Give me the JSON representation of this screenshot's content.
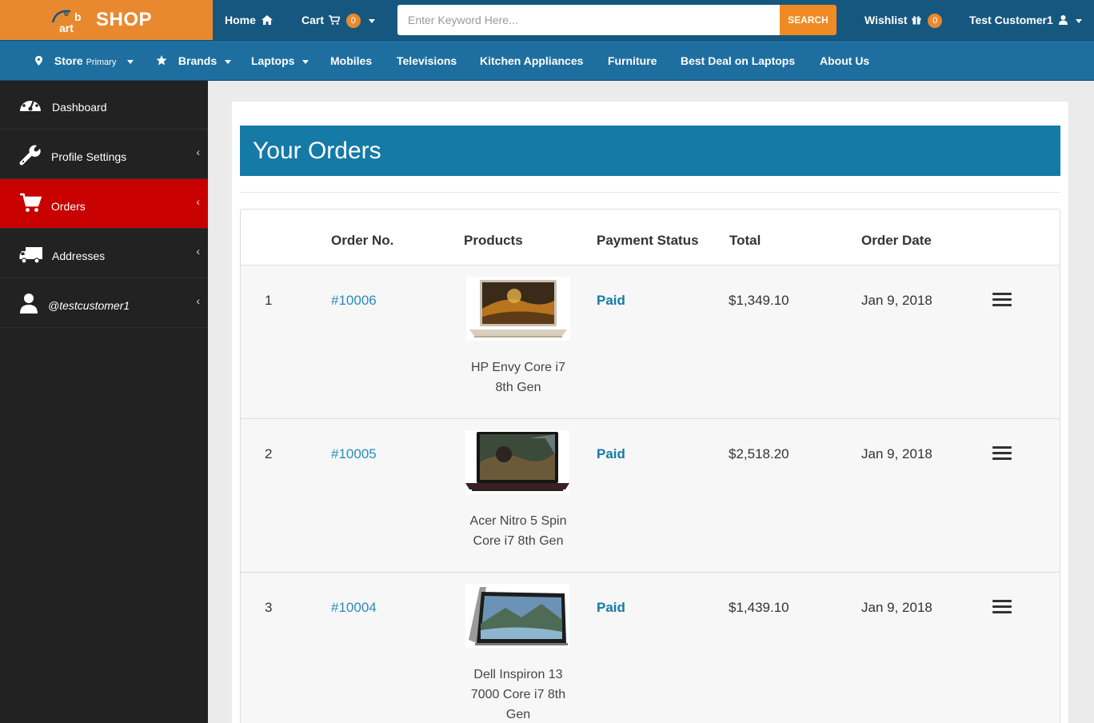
{
  "brand": {
    "logo_letters": [
      "e",
      "b",
      "art"
    ],
    "name": "SHOP"
  },
  "topnav": {
    "home": "Home",
    "cart": "Cart",
    "cart_count": "0",
    "search_placeholder": "Enter Keyword Here...",
    "search_button": "SEARCH",
    "wishlist": "Wishlist",
    "wishlist_count": "0",
    "user": "Test Customer1"
  },
  "nav2": {
    "store": "Store",
    "store_sub": "Primary",
    "brands": "Brands",
    "laptops": "Laptops",
    "mobiles": "Mobiles",
    "televisions": "Televisions",
    "kitchen": "Kitchen Appliances",
    "furniture": "Furniture",
    "best_deal": "Best Deal on Laptops",
    "about": "About Us"
  },
  "sidebar": {
    "items": [
      {
        "label": "Dashboard",
        "icon": "dashboard-icon"
      },
      {
        "label": "Profile Settings",
        "icon": "wrench-icon"
      },
      {
        "label": "Orders",
        "icon": "cart-icon"
      },
      {
        "label": "Addresses",
        "icon": "truck-icon"
      },
      {
        "label": "@testcustomer1",
        "icon": "user-icon"
      }
    ]
  },
  "page": {
    "title": "Your Orders"
  },
  "table": {
    "headers": [
      "Order No.",
      "Products",
      "Payment Status",
      "Total",
      "Order Date"
    ],
    "rows": [
      {
        "index": "1",
        "order_no": "#10006",
        "product_line1": "HP Envy Core i7",
        "product_line2": "8th Gen",
        "product_line3": "",
        "status": "Paid",
        "total": "$1,349.10",
        "date": "Jan 9, 2018"
      },
      {
        "index": "2",
        "order_no": "#10005",
        "product_line1": "Acer Nitro 5 Spin",
        "product_line2": "Core i7 8th Gen",
        "product_line3": "",
        "status": "Paid",
        "total": "$2,518.20",
        "date": "Jan 9, 2018"
      },
      {
        "index": "3",
        "order_no": "#10004",
        "product_line1": "Dell Inspiron 13",
        "product_line2": "7000 Core i7 8th",
        "product_line3": "Gen",
        "status": "Paid",
        "total": "$1,439.10",
        "date": "Jan 9, 2018"
      }
    ]
  },
  "colors": {
    "orange": "#e8892f",
    "topbar": "#16577f",
    "navbar": "#1e6fa0",
    "sidebar": "#222222",
    "active": "#c80000",
    "header": "#157aa6",
    "link": "#2a8bbf"
  }
}
